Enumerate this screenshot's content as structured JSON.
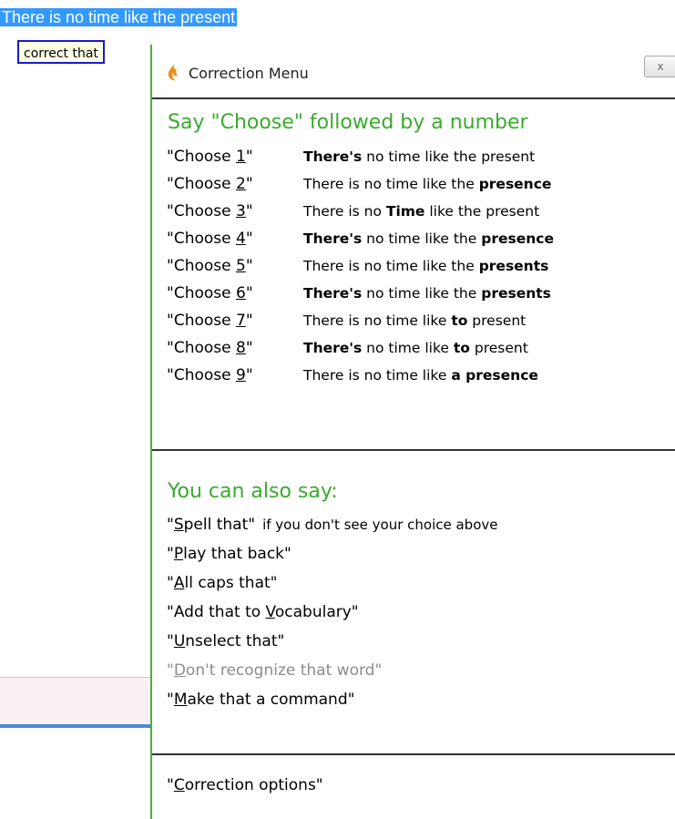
{
  "document": {
    "selected_text": "There is no time like the present",
    "recognized_command": "correct that"
  },
  "menu": {
    "title": "Correction Menu",
    "close_label": "x",
    "choose_heading": "Say \"Choose\" followed by a number",
    "choices": [
      {
        "pre": "\"Choose ",
        "num": "1",
        "post": "\"",
        "segments": [
          {
            "t": "There's",
            "b": true
          },
          {
            "t": " no time like the present",
            "b": false
          }
        ]
      },
      {
        "pre": "\"Choose ",
        "num": "2",
        "post": "\"",
        "segments": [
          {
            "t": "There is no time like the ",
            "b": false
          },
          {
            "t": "presence",
            "b": true
          }
        ]
      },
      {
        "pre": "\"Choose ",
        "num": "3",
        "post": "\"",
        "segments": [
          {
            "t": "There is no ",
            "b": false
          },
          {
            "t": "Time",
            "b": true
          },
          {
            "t": " like the present",
            "b": false
          }
        ]
      },
      {
        "pre": "\"Choose ",
        "num": "4",
        "post": "\"",
        "segments": [
          {
            "t": "There's",
            "b": true
          },
          {
            "t": " no time like the ",
            "b": false
          },
          {
            "t": "presence",
            "b": true
          }
        ]
      },
      {
        "pre": "\"Choose ",
        "num": "5",
        "post": "\"",
        "segments": [
          {
            "t": "There is no time like the ",
            "b": false
          },
          {
            "t": "presents",
            "b": true
          }
        ]
      },
      {
        "pre": "\"Choose ",
        "num": "6",
        "post": "\"",
        "segments": [
          {
            "t": "There's",
            "b": true
          },
          {
            "t": " no time like the ",
            "b": false
          },
          {
            "t": "presents",
            "b": true
          }
        ]
      },
      {
        "pre": "\"Choose ",
        "num": "7",
        "post": "\"",
        "segments": [
          {
            "t": "There is no time like ",
            "b": false
          },
          {
            "t": "to",
            "b": true
          },
          {
            "t": " present",
            "b": false
          }
        ]
      },
      {
        "pre": "\"Choose ",
        "num": "8",
        "post": "\"",
        "segments": [
          {
            "t": "There's",
            "b": true
          },
          {
            "t": " no time like ",
            "b": false
          },
          {
            "t": "to",
            "b": true
          },
          {
            "t": " present",
            "b": false
          }
        ]
      },
      {
        "pre": "\"Choose ",
        "num": "9",
        "post": "\"",
        "segments": [
          {
            "t": "There is no time like ",
            "b": false
          },
          {
            "t": "a presence",
            "b": true
          }
        ]
      }
    ],
    "also_heading": "You can also say:",
    "commands": [
      {
        "pre": "\"",
        "key": "S",
        "rest": "pell that\"",
        "hint": "if you don't see your choice above",
        "disabled": false
      },
      {
        "pre": "\"",
        "key": "P",
        "rest": "lay that back\"",
        "hint": "",
        "disabled": false
      },
      {
        "pre": "\"",
        "key": "A",
        "rest": "ll caps that\"",
        "hint": "",
        "disabled": false
      },
      {
        "pre": "\"Add that to ",
        "key": "V",
        "rest": "ocabulary\"",
        "hint": "",
        "disabled": false
      },
      {
        "pre": "\"",
        "key": "U",
        "rest": "nselect that\"",
        "hint": "",
        "disabled": false
      },
      {
        "pre": "\"",
        "key": "D",
        "rest": "on't recognize that word\"",
        "hint": "",
        "disabled": true
      },
      {
        "pre": "\"",
        "key": "M",
        "rest": "ake that a command\"",
        "hint": "",
        "disabled": false
      }
    ],
    "options": {
      "pre": "\"",
      "key": "C",
      "rest": "orrection options\""
    }
  },
  "colors": {
    "selection": "#3399ff",
    "heading_green": "#3aaa2e",
    "menu_border": "#4caf36",
    "command_box_border": "#1a1acc",
    "disabled_text": "#8c8c8c"
  },
  "icons": {
    "title_icon": "dragon-flame-icon",
    "close_icon": "close-icon"
  }
}
